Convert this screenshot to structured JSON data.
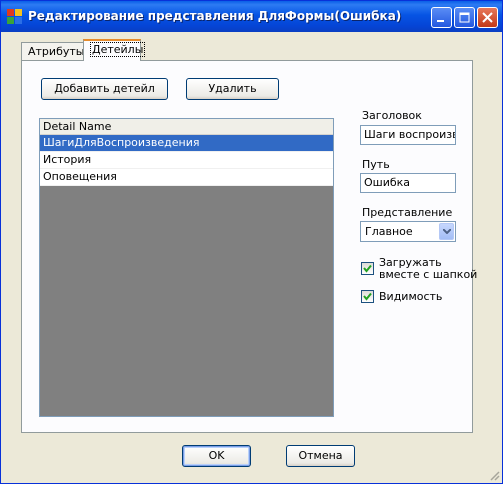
{
  "window": {
    "title": "Редактирование представления ДляФормы(Ошибка)",
    "controls": {
      "minimize": "minimize-icon",
      "maximize": "maximize-icon",
      "close": "close-icon"
    }
  },
  "tabs": [
    {
      "label": "Атрибуты",
      "active": false
    },
    {
      "label": "Детейлы",
      "active": true
    }
  ],
  "toolbar": {
    "add_label": "Добавить детейл",
    "delete_label": "Удалить"
  },
  "details_list": {
    "header": "Detail Name",
    "rows": [
      {
        "label": "ШагиДляВоспроизведения",
        "selected": true
      },
      {
        "label": "История",
        "selected": false
      },
      {
        "label": "Оповещения",
        "selected": false
      }
    ]
  },
  "properties": {
    "caption_label": "Заголовок",
    "caption_value": "Шаги воспроизве",
    "path_label": "Путь",
    "path_value": "Ошибка",
    "view_label": "Представление",
    "view_value": "Главное",
    "load_with_header_label_line1": "Загружать",
    "load_with_header_label_line2": "вместе с шапкой",
    "load_with_header_checked": true,
    "visible_label": "Видимость",
    "visible_checked": true
  },
  "footer": {
    "ok_label": "OK",
    "cancel_label": "Отмена"
  },
  "colors": {
    "titlebar": "#0a5fe8",
    "selection": "#316ac5",
    "list_background": "#808080",
    "dialog_background": "#ece9d8"
  }
}
